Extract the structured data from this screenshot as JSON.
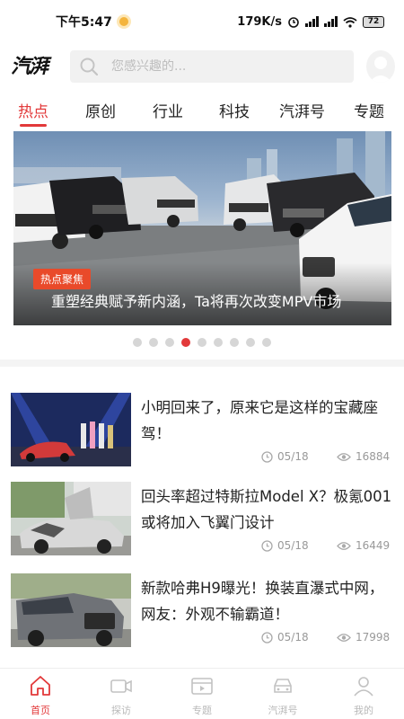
{
  "status": {
    "time": "下午5:47",
    "net_speed": "179K/s",
    "battery": "72"
  },
  "header": {
    "logo": "汽湃",
    "search_placeholder": "您感兴趣的..."
  },
  "tabs": [
    "热点",
    "原创",
    "行业",
    "科技",
    "汽湃号",
    "专题"
  ],
  "active_tab": "热点",
  "banner": {
    "tag": "热点聚焦",
    "title": "重塑经典赋予新内涵，Ta将再次改变MPV市场",
    "dot_count": 9,
    "active_dot": 3
  },
  "news": [
    {
      "title": "小明回来了，原来它是这样的宝藏座驾！",
      "date": "05/18",
      "views": "16884"
    },
    {
      "title": "回头率超过特斯拉Model X？极氪001或将加入飞翼门设计",
      "date": "05/18",
      "views": "16449"
    },
    {
      "title": "新款哈弗H9曝光！换装直瀑式中网，网友：外观不输霸道！",
      "date": "05/18",
      "views": "17998"
    }
  ],
  "bottom_nav": [
    "首页",
    "探访",
    "专题",
    "汽湃号",
    "我的"
  ],
  "colors": {
    "accent": "#e2393a",
    "banner_tag": "#e94a2a",
    "muted": "#999999"
  }
}
